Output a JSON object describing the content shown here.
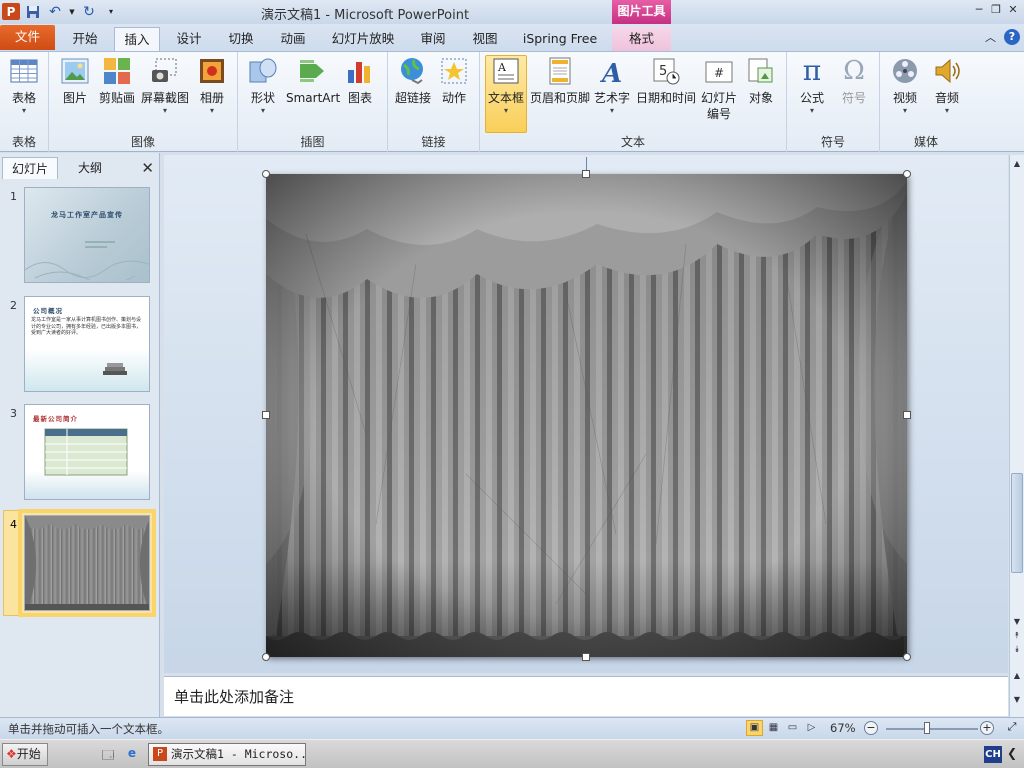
{
  "window": {
    "title": "演示文稿1 - Microsoft PowerPoint",
    "context_header": "图片工具"
  },
  "qat": {
    "save_icon": "save-icon",
    "undo_icon": "undo-icon",
    "redo_icon": "redo-icon",
    "app_icon_letter": "P"
  },
  "tabs": [
    {
      "label": "文件"
    },
    {
      "label": "开始"
    },
    {
      "label": "插入"
    },
    {
      "label": "设计"
    },
    {
      "label": "切换"
    },
    {
      "label": "动画"
    },
    {
      "label": "幻灯片放映"
    },
    {
      "label": "审阅"
    },
    {
      "label": "视图"
    },
    {
      "label": "iSpring Free"
    },
    {
      "label": "格式"
    }
  ],
  "active_tab": "插入",
  "ribbon": {
    "groups": {
      "tables": "表格",
      "images": "图像",
      "illustrations": "插图",
      "links": "链接",
      "text": "文本",
      "symbols": "符号",
      "media": "媒体"
    },
    "buttons": {
      "table": "表格",
      "picture": "图片",
      "clipart": "剪贴画",
      "screenshot": "屏幕截图",
      "album": "相册",
      "shapes": "形状",
      "smartart": "SmartArt",
      "chart": "图表",
      "hyperlink": "超链接",
      "action": "动作",
      "textbox": "文本框",
      "header_footer": "页眉和页脚",
      "wordart": "艺术字",
      "datetime": "日期和时间",
      "slide_number_1": "幻灯片",
      "slide_number_2": "编号",
      "object": "对象",
      "equation": "公式",
      "symbol": "符号",
      "video": "视频",
      "audio": "音频"
    },
    "glyphs": {
      "pi": "π",
      "omega": "Ω"
    }
  },
  "left_pane": {
    "tab_slides": "幻灯片",
    "tab_outline": "大纲",
    "slides": [
      {
        "number": "1",
        "title": "龙马工作室产品宣传"
      },
      {
        "number": "2",
        "title": "公司概况",
        "body": "龙马工作室是一家从事计算机图书创作、策划与设计的专业公司，拥有多年经验，已出版多本图书，受到广大读者的好评。"
      },
      {
        "number": "3",
        "title": "最新公司简介"
      },
      {
        "number": "4"
      }
    ]
  },
  "notes": {
    "placeholder": "单击此处添加备注"
  },
  "status": {
    "message": "单击并拖动可插入一个文本框。",
    "zoom": "67%",
    "zoom_fraction": 0.45
  },
  "taskbar": {
    "start": "开始",
    "task_item": "演示文稿1 - Microso...",
    "tray_lang": "CH"
  }
}
